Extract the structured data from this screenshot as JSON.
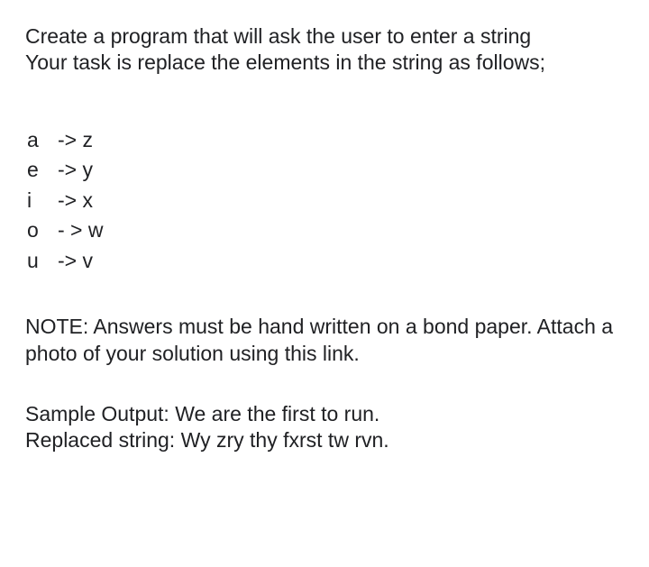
{
  "intro": {
    "line1": "Create a program that will ask the user to enter a string",
    "line2": "Your task is replace the elements in the string as follows;"
  },
  "mappings": [
    {
      "from": "a",
      "arrow": "-> z"
    },
    {
      "from": "e",
      "arrow": "-> y"
    },
    {
      "from": "i",
      "arrow": "-> x"
    },
    {
      "from": "o",
      "arrow": "- > w"
    },
    {
      "from": "u",
      "arrow": "-> v"
    }
  ],
  "note": {
    "text": "NOTE:  Answers must be hand written on a bond paper. Attach a photo of your solution using this link."
  },
  "sample": {
    "line1": "Sample Output: We are the first to run.",
    "line2": "Replaced string: Wy zry thy fxrst tw rvn."
  }
}
